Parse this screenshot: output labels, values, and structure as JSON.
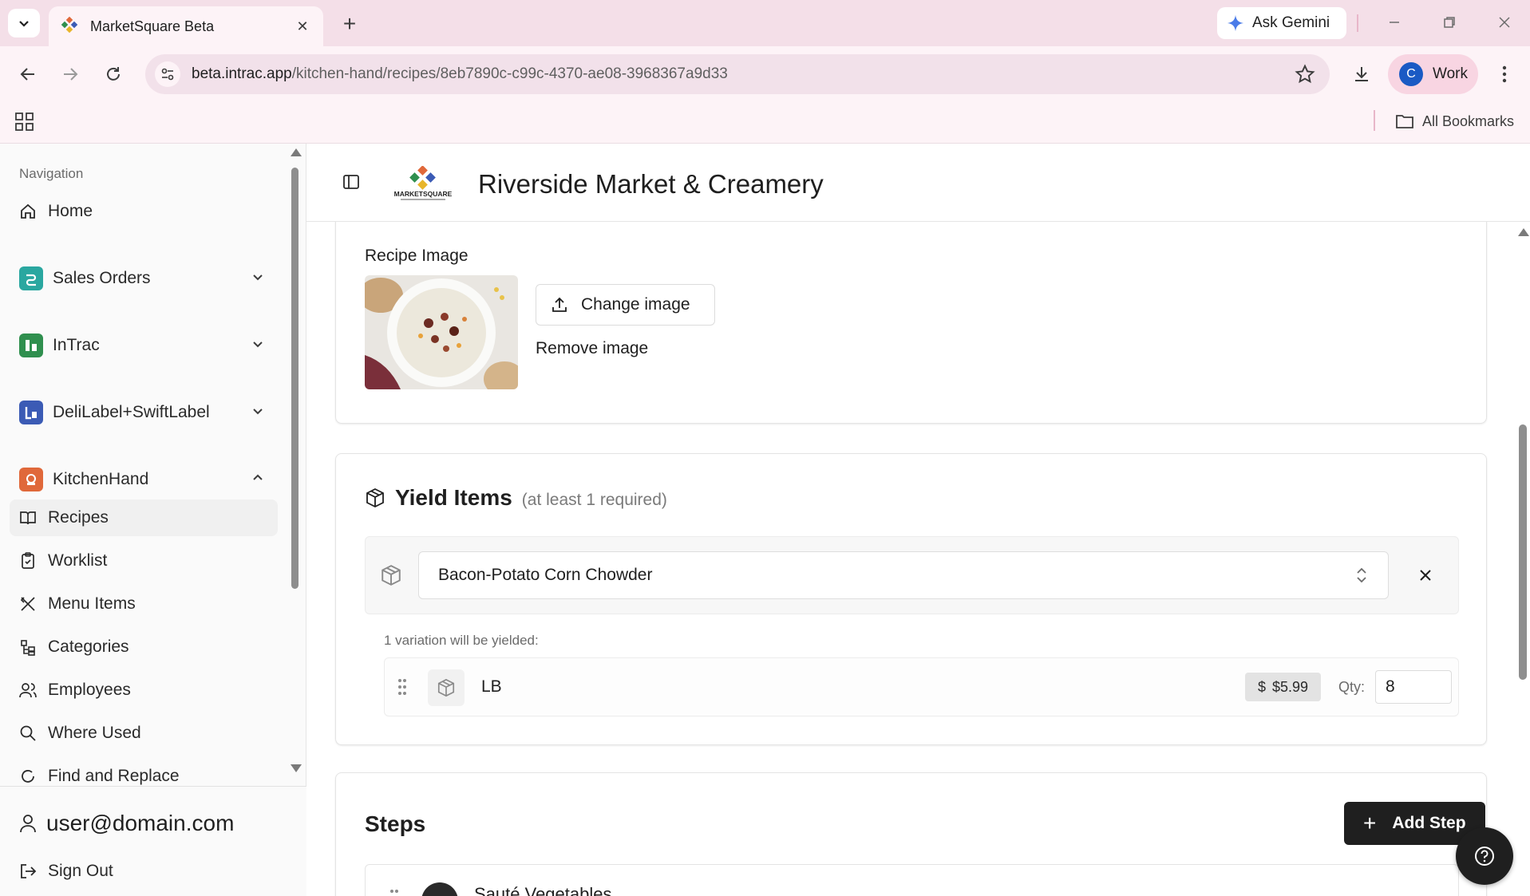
{
  "browser": {
    "tab_title": "MarketSquare Beta",
    "ask_gemini_label": "Ask Gemini",
    "url_host": "beta.intrac.app",
    "url_path": "/kitchen-hand/recipes/8eb7890c-c99c-4370-ae08-3968367a9d33",
    "profile_initial": "C",
    "profile_label": "Work",
    "all_bookmarks_label": "All Bookmarks"
  },
  "sidebar": {
    "heading": "Navigation",
    "home_label": "Home",
    "groups": [
      {
        "label": "Sales Orders",
        "color": "#2aa7a0",
        "expanded": false
      },
      {
        "label": "InTrac",
        "color": "#2f8f4e",
        "expanded": false
      },
      {
        "label": "DeliLabel+SwiftLabel",
        "color": "#3b5bb5",
        "expanded": false
      },
      {
        "label": "KitchenHand",
        "color": "#e0683a",
        "expanded": true
      }
    ],
    "kitchenhand_items": [
      "Recipes",
      "Worklist",
      "Menu Items",
      "Categories",
      "Employees",
      "Where Used",
      "Find and Replace"
    ],
    "active_item": "Recipes",
    "user_email": "user@domain.com",
    "sign_out_label": "Sign Out"
  },
  "header": {
    "logo_text": "MARKETSQUARE",
    "company_name": "Riverside Market & Creamery"
  },
  "recipe_image": {
    "label": "Recipe Image",
    "change_label": "Change image",
    "remove_label": "Remove image"
  },
  "yield_items": {
    "title": "Yield Items",
    "requirement": "(at least 1 required)",
    "selected_item": "Bacon-Potato Corn Chowder",
    "variation_note": "1 variation will be yielded:",
    "variations": [
      {
        "unit": "LB",
        "currency": "$",
        "price": "$5.99",
        "qty_label": "Qty:",
        "qty": "8"
      }
    ]
  },
  "steps": {
    "title": "Steps",
    "add_label": "Add Step",
    "first_step_name": "Sauté Vegetables"
  }
}
